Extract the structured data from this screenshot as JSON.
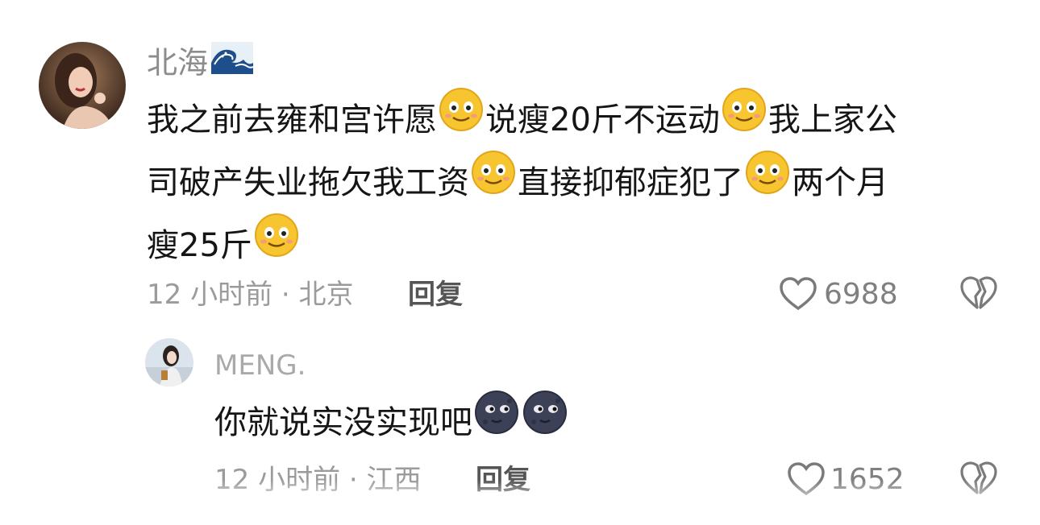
{
  "comments": [
    {
      "username": "北海",
      "username_emoji": "wave-emoji",
      "text_lines": [
        "我之前去雍和宫许愿",
        "说瘦20斤不运动",
        "我上家公"
      ],
      "segments": {
        "l1a": "我之前去雍和宫许愿",
        "l1b": "说瘦20斤不运动",
        "l1c": "我上家公",
        "l2a": "司破产失业拖欠我工资",
        "l2b": "直接抑郁症犯了",
        "l2c": "两个月",
        "l3a": "瘦25斤"
      },
      "inline_emoji": "smiling-face-emoji",
      "time": "12 小时前",
      "location": "北京",
      "reply_label": "回复",
      "like_count": "6988"
    },
    {
      "username": "MENG.",
      "segments": {
        "l1a": "你就说实没实现吧"
      },
      "inline_emoji": "new-moon-face-emoji",
      "time": "12 小时前",
      "location": "江西",
      "reply_label": "回复",
      "like_count": "1652"
    }
  ],
  "separator": "·",
  "colors": {
    "background": "#ffffff",
    "text": "#151515",
    "meta": "#9b9b9b",
    "username": "#8c8c8c",
    "emoji_yellow": "#f7c530",
    "moon_face": "#3d4157"
  }
}
